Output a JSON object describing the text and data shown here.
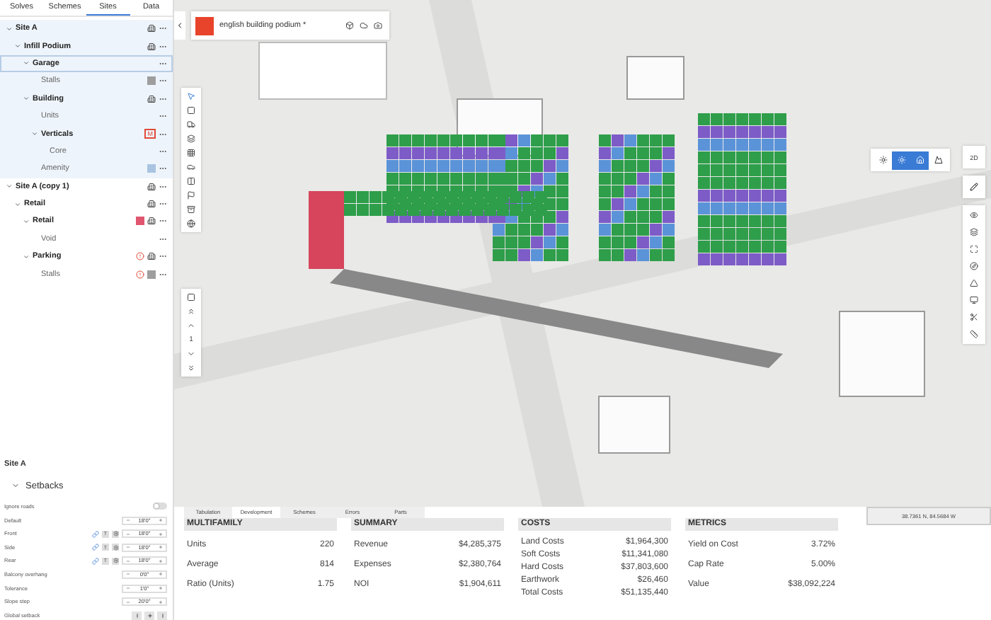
{
  "sidebar": {
    "tabs": [
      {
        "label": "Solves",
        "selected": false
      },
      {
        "label": "Schemes",
        "selected": false
      },
      {
        "label": "Sites",
        "selected": true
      },
      {
        "label": "Data",
        "selected": false
      }
    ],
    "tree": [
      {
        "label": "Site A",
        "active": true,
        "selected": false,
        "expanded": true,
        "badges": [
          {
            "kind": "building"
          }
        ],
        "children": [
          {
            "label": "Infill Podium",
            "selected": false,
            "expanded": true,
            "badges": [
              {
                "kind": "building"
              }
            ],
            "children": [
              {
                "label": "Garage",
                "selected": true,
                "expanded": true,
                "children": [
                  {
                    "label": "Stalls",
                    "selected": false,
                    "badges": [
                      {
                        "kind": "swatch",
                        "color": "#9e9e9e"
                      }
                    ]
                  }
                ]
              },
              {
                "label": "Building",
                "selected": false,
                "expanded": true,
                "badges": [
                  {
                    "kind": "building"
                  }
                ],
                "children": [
                  {
                    "label": "Units",
                    "selected": false
                  },
                  {
                    "label": "Verticals",
                    "selected": false,
                    "expanded": true,
                    "badges": [
                      {
                        "kind": "tag",
                        "text": "M"
                      }
                    ],
                    "children": [
                      {
                        "label": "Core",
                        "selected": false
                      }
                    ]
                  },
                  {
                    "label": "Amenity",
                    "selected": false,
                    "badges": [
                      {
                        "kind": "swatch",
                        "color": "#a9c4e0"
                      }
                    ]
                  }
                ]
              }
            ]
          }
        ]
      },
      {
        "label": "Site A (copy 1)",
        "active": false,
        "selected": false,
        "expanded": true,
        "badges": [
          {
            "kind": "building"
          }
        ],
        "children": [
          {
            "label": "Retail",
            "selected": false,
            "expanded": true,
            "badges": [
              {
                "kind": "building"
              }
            ],
            "children": [
              {
                "label": "Retail",
                "selected": false,
                "expanded": true,
                "badges": [
                  {
                    "kind": "swatch",
                    "color": "#e0566e"
                  },
                  {
                    "kind": "building"
                  }
                ],
                "children": [
                  {
                    "label": "Void",
                    "selected": false
                  }
                ]
              },
              {
                "label": "Parking",
                "selected": false,
                "expanded": true,
                "badges": [
                  {
                    "kind": "warning"
                  },
                  {
                    "kind": "building"
                  }
                ],
                "children": [
                  {
                    "label": "Stalls",
                    "selected": false,
                    "badges": [
                      {
                        "kind": "warning"
                      },
                      {
                        "kind": "swatch",
                        "color": "#9e9e9e"
                      }
                    ]
                  }
                ]
              }
            ]
          }
        ]
      }
    ]
  },
  "properties": {
    "title": "Site A",
    "section": {
      "label": "Setbacks",
      "expanded": true
    },
    "rows": [
      {
        "kind": "toggle",
        "label": "Ignore roads",
        "on": false
      },
      {
        "kind": "stepper",
        "label": "Default",
        "value": "18'0\""
      },
      {
        "kind": "stepper",
        "label": "Front",
        "value": "18'0\"",
        "tools": true,
        "tool_text": "T"
      },
      {
        "kind": "stepper",
        "label": "Side",
        "value": "18'0\"",
        "tools": true,
        "tool_text": "T"
      },
      {
        "kind": "stepper",
        "label": "Rear",
        "value": "18'0\"",
        "tools": true,
        "tool_text": "T"
      },
      {
        "kind": "stepper",
        "label": "Balcony overhang",
        "value": "0'0\""
      },
      {
        "kind": "stepper",
        "label": "Tolerance",
        "value": "1'0\""
      },
      {
        "kind": "stepper",
        "label": "Slope step",
        "value": "20'0\""
      },
      {
        "kind": "buttons",
        "label": "Global setback"
      }
    ]
  },
  "project": {
    "name": "english building podium *"
  },
  "map_toolbar": {
    "level": "1"
  },
  "view_modes": [
    {
      "selected": false
    },
    {
      "selected": true
    },
    {
      "selected": true
    },
    {
      "selected": false
    }
  ],
  "view_2d": "2D",
  "coordinates": "38.7361 N, 84.5684 W",
  "bottom": {
    "tabs": [
      {
        "label": "Tabulation",
        "selected": false
      },
      {
        "label": "Development",
        "selected": true
      },
      {
        "label": "Schemes",
        "selected": false
      },
      {
        "label": "Errors",
        "selected": false
      },
      {
        "label": "Parts",
        "selected": false
      }
    ],
    "tables": [
      {
        "title": "MULTIFAMILY",
        "dense": false,
        "rows": [
          [
            "Units",
            "220"
          ],
          [
            "Average",
            "814"
          ],
          [
            "Ratio (Units)",
            "1.75"
          ]
        ]
      },
      {
        "title": "SUMMARY",
        "dense": false,
        "rows": [
          [
            "Revenue",
            "$4,285,375"
          ],
          [
            "Expenses",
            "$2,380,764"
          ],
          [
            "NOI",
            "$1,904,611"
          ]
        ]
      },
      {
        "title": "COSTS",
        "dense": true,
        "rows": [
          [
            "Land Costs",
            "$1,964,300"
          ],
          [
            "Soft Costs",
            "$11,341,080"
          ],
          [
            "Hard Costs",
            "$37,803,600"
          ],
          [
            "Earthwork",
            "$26,460"
          ],
          [
            "Total Costs",
            "$51,135,440"
          ]
        ]
      },
      {
        "title": "METRICS",
        "dense": false,
        "rows": [
          [
            "Yield on Cost",
            "3.72%"
          ],
          [
            "Cap Rate",
            "5.00%"
          ],
          [
            "Value",
            "$38,092,224"
          ]
        ]
      }
    ]
  }
}
